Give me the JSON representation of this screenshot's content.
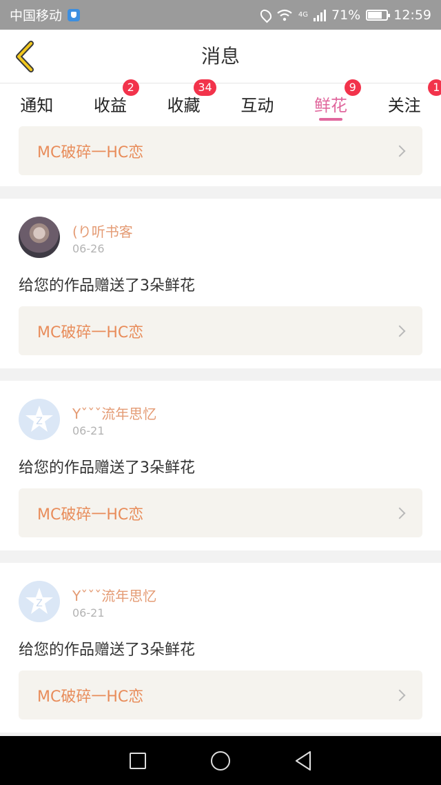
{
  "statusbar": {
    "carrier": "中国移动",
    "network": "4G",
    "battery": "71%",
    "time": "12:59"
  },
  "header": {
    "title": "消息"
  },
  "tabs": [
    {
      "label": "通知",
      "badge": ""
    },
    {
      "label": "收益",
      "badge": "2"
    },
    {
      "label": "收藏",
      "badge": "34"
    },
    {
      "label": "互动",
      "badge": ""
    },
    {
      "label": "鲜花",
      "badge": "9",
      "active": true
    },
    {
      "label": "关注",
      "badge": "1"
    }
  ],
  "messages": [
    {
      "work": "MC破碎一HC恋"
    },
    {
      "user": "(り听书客",
      "date": "06-26",
      "text": "给您的作品赠送了3朵鲜花",
      "work": "MC破碎一HC恋",
      "avatar": "photo-avatar"
    },
    {
      "user": "Yˇˇˇ流年思忆",
      "date": "06-21",
      "text": "给您的作品赠送了3朵鲜花",
      "work": "MC破碎一HC恋",
      "avatar": "default-avatar"
    },
    {
      "user": "Yˇˇˇ流年思忆",
      "date": "06-21",
      "text": "给您的作品赠送了3朵鲜花",
      "work": "MC破碎一HC恋",
      "avatar": "default-avatar"
    }
  ],
  "colors": {
    "accent": "#e0679d",
    "badge": "#f2334b",
    "username": "#e49b74",
    "work_title": "#e88c5a",
    "back_arrow": "#f2c81e"
  }
}
